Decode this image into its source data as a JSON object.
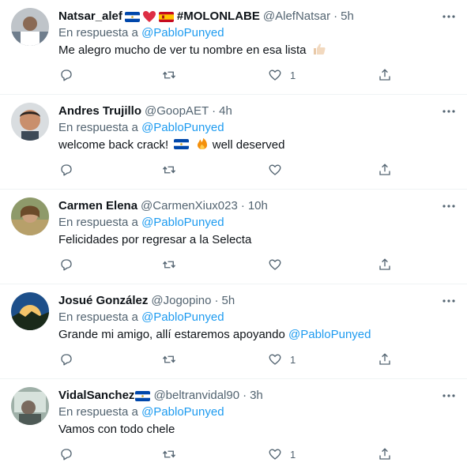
{
  "reply_prefix": "En respuesta a",
  "tweets": [
    {
      "name": "Natsar_alef",
      "name_suffix": "#MOLONLABE",
      "handle": "@AlefNatsar",
      "time": "5h",
      "reply_to": "@PabloPunyed",
      "text": "Me alegro mucho de ver tu nombre en esa lista",
      "likes": "1"
    },
    {
      "name": "Andres Trujillo",
      "handle": "@GoopAET",
      "time": "4h",
      "reply_to": "@PabloPunyed",
      "text_before": "welcome back crack!",
      "text_after": "well deserved",
      "likes": ""
    },
    {
      "name": "Carmen Elena",
      "handle": "@CarmenXiux023",
      "time": "10h",
      "reply_to": "@PabloPunyed",
      "text": "Felicidades por regresar a la Selecta",
      "likes": ""
    },
    {
      "name": "Josué González",
      "handle": "@Jogopino",
      "time": "5h",
      "reply_to": "@PabloPunyed",
      "text": "Grande mi amigo, allí estaremos apoyando",
      "text_mention": "@PabloPunyed",
      "likes": "1"
    },
    {
      "name": "VidalSanchez",
      "handle": "@beltranvidal90",
      "time": "3h",
      "reply_to": "@PabloPunyed",
      "text": "Vamos con todo chele",
      "likes": "1"
    }
  ],
  "icons": {
    "reply": "reply-icon",
    "retweet": "retweet-icon",
    "like": "heart-icon",
    "share": "share-icon",
    "more": "more-icon"
  },
  "colors": {
    "link": "#1d9bf0",
    "secondary": "#536471",
    "text": "#0f1419"
  }
}
